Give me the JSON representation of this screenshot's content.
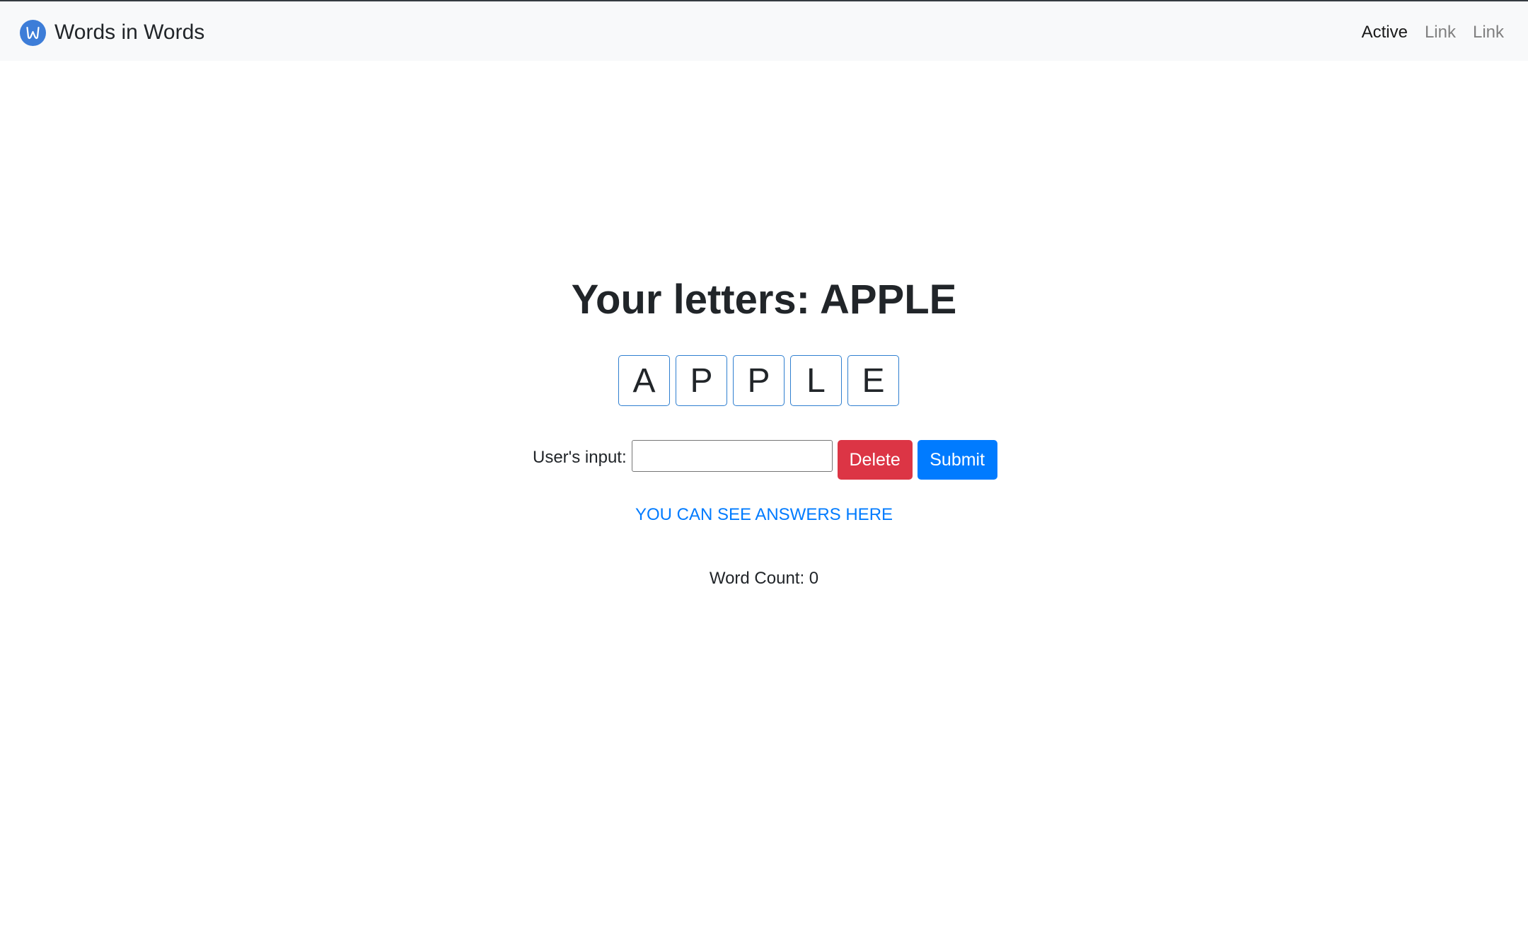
{
  "navbar": {
    "brand_logo_icon": "w-circle-logo-icon",
    "brand_text": "Words in Words",
    "links": [
      {
        "label": "Active",
        "active": true
      },
      {
        "label": "Link",
        "active": false
      },
      {
        "label": "Link",
        "active": false
      }
    ]
  },
  "main": {
    "title": "Your letters: APPLE",
    "letters": [
      "A",
      "P",
      "P",
      "L",
      "E"
    ],
    "input_label": "User's input:",
    "input_value": "",
    "delete_label": "Delete",
    "submit_label": "Submit",
    "answers_link": "YOU CAN SEE ANSWERS HERE",
    "word_count": "Word Count: 0"
  },
  "colors": {
    "navbar_bg": "#f8f9fa",
    "delete": "#dc3545",
    "submit": "#007bff",
    "link": "#007bff",
    "tile_border": "#2f7fd0",
    "logo": "#3d7dd8"
  }
}
